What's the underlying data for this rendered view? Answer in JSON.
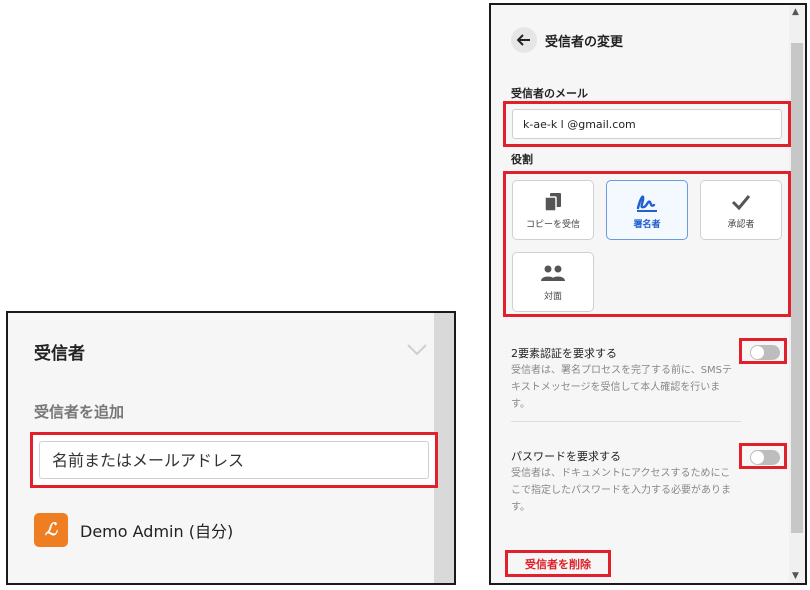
{
  "left": {
    "title": "受信者",
    "subtitle": "受信者を追加",
    "input_placeholder": "名前またはメールアドレス",
    "user": {
      "avatar_glyph": "ℒ",
      "name": "Demo Admin (自分)",
      "avatar_color": "#ef7d22"
    }
  },
  "right": {
    "header": {
      "back_icon": "arrow-left-icon",
      "title": "受信者の変更"
    },
    "email_label": "受信者のメール",
    "email_value": "k-ae-k l @gmail.com",
    "role_label": "役割",
    "roles": [
      {
        "label": "コピーを受信",
        "icon": "copy-icon",
        "selected": false
      },
      {
        "label": "署名者",
        "icon": "signature-icon",
        "selected": true
      },
      {
        "label": "承認者",
        "icon": "check-icon",
        "selected": false
      },
      {
        "label": "対面",
        "icon": "people-icon",
        "selected": false
      }
    ],
    "two_factor": {
      "title": "2要素認証を要求する",
      "description": "受信者は、署名プロセスを完了する前に、SMSテキストメッセージを受信して本人確認を行います。",
      "enabled": false
    },
    "password": {
      "title": "パスワードを要求する",
      "description": "受信者は、ドキュメントにアクセスするためにここで指定したパスワードを入力する必要があります。",
      "enabled": false
    },
    "delete_label": "受信者を削除"
  },
  "colors": {
    "highlight": "#e0202a",
    "accent_blue": "#1f5fcf",
    "avatar_orange": "#ef7d22"
  }
}
